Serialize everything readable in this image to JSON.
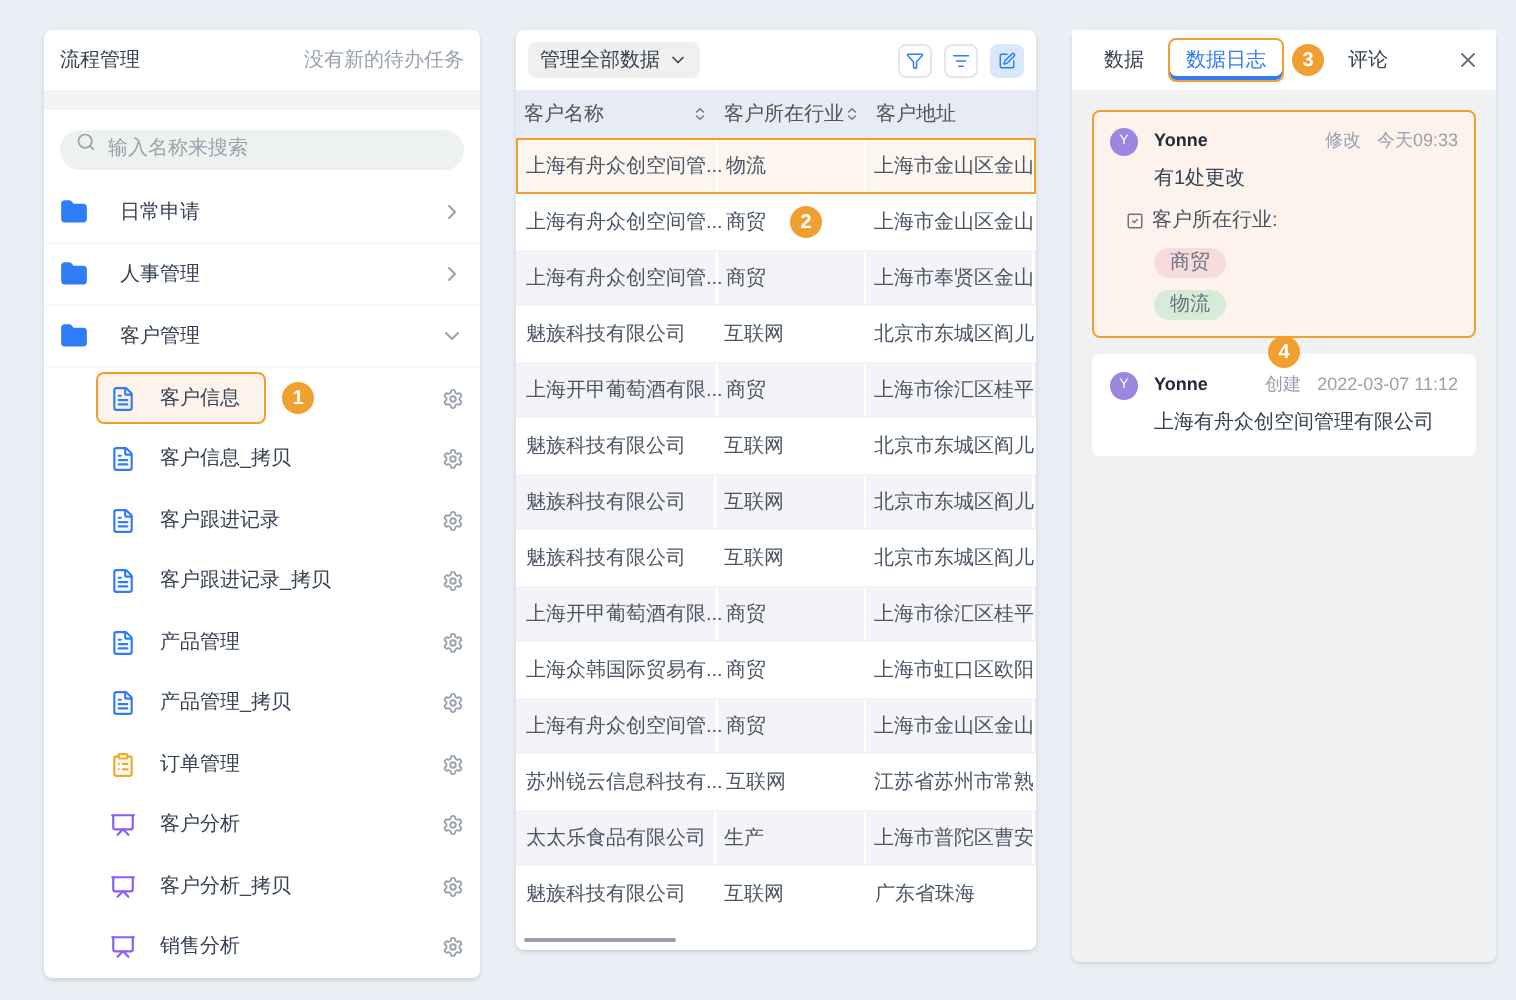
{
  "left_panel": {
    "title": "流程管理",
    "notice": "没有新的待办任务",
    "search": {
      "placeholder": "输入名称来搜索"
    },
    "folders": [
      {
        "label": "日常申请",
        "expanded": false
      },
      {
        "label": "人事管理",
        "expanded": false
      },
      {
        "label": "客户管理",
        "expanded": true,
        "children": [
          {
            "label": "客户信息",
            "kind": "form",
            "selected": true,
            "badge": "1"
          },
          {
            "label": "客户信息_拷贝",
            "kind": "form",
            "selected": false
          },
          {
            "label": "客户跟进记录",
            "kind": "form",
            "selected": false
          },
          {
            "label": "客户跟进记录_拷贝",
            "kind": "form",
            "selected": false
          },
          {
            "label": "产品管理",
            "kind": "form",
            "selected": false
          },
          {
            "label": "产品管理_拷贝",
            "kind": "form",
            "selected": false
          },
          {
            "label": "订单管理",
            "kind": "flow",
            "selected": false
          },
          {
            "label": "客户分析",
            "kind": "report",
            "selected": false
          },
          {
            "label": "客户分析_拷贝",
            "kind": "report",
            "selected": false
          },
          {
            "label": "销售分析",
            "kind": "report",
            "selected": false
          }
        ]
      }
    ]
  },
  "middle_panel": {
    "view_select": "管理全部数据",
    "table": {
      "columns": [
        "客户名称",
        "客户所在行业",
        "客户地址"
      ],
      "rows": [
        {
          "cells": [
            "上海有舟众创空间管...",
            "物流",
            "上海市金山区金山"
          ],
          "selected": true
        },
        {
          "cells": [
            "上海有舟众创空间管...",
            "商贸",
            "上海市金山区金山"
          ],
          "selected": false,
          "badge": "2"
        },
        {
          "cells": [
            "上海有舟众创空间管...",
            "商贸",
            "上海市奉贤区金山"
          ],
          "selected": false
        },
        {
          "cells": [
            "魅族科技有限公司",
            "互联网",
            "北京市东城区阎儿"
          ],
          "selected": false
        },
        {
          "cells": [
            "上海开甲葡萄酒有限...",
            "商贸",
            "上海市徐汇区桂平"
          ],
          "selected": false
        },
        {
          "cells": [
            "魅族科技有限公司",
            "互联网",
            "北京市东城区阎儿"
          ],
          "selected": false
        },
        {
          "cells": [
            "魅族科技有限公司",
            "互联网",
            "北京市东城区阎儿"
          ],
          "selected": false
        },
        {
          "cells": [
            "魅族科技有限公司",
            "互联网",
            "北京市东城区阎儿"
          ],
          "selected": false
        },
        {
          "cells": [
            "上海开甲葡萄酒有限...",
            "商贸",
            "上海市徐汇区桂平"
          ],
          "selected": false
        },
        {
          "cells": [
            "上海众韩国际贸易有...",
            "商贸",
            "上海市虹口区欧阳"
          ],
          "selected": false
        },
        {
          "cells": [
            "上海有舟众创空间管...",
            "商贸",
            "上海市金山区金山"
          ],
          "selected": false
        },
        {
          "cells": [
            "苏州锐云信息科技有...",
            "互联网",
            "江苏省苏州市常熟"
          ],
          "selected": false
        },
        {
          "cells": [
            "太太乐食品有限公司",
            "生产",
            "上海市普陀区曹安"
          ],
          "selected": false
        },
        {
          "cells": [
            "魅族科技有限公司",
            "互联网",
            "广东省珠海"
          ],
          "selected": false
        }
      ]
    }
  },
  "right_panel": {
    "tabs": [
      {
        "label": "数据",
        "selected": false
      },
      {
        "label": "数据日志",
        "selected": true,
        "badge": "3"
      },
      {
        "label": "评论",
        "selected": false
      }
    ],
    "logs": [
      {
        "avatar": "Y",
        "user": "Yonne",
        "action": "修改",
        "time": "今天09:33",
        "selected": true,
        "summary": "有1处更改",
        "field": "客户所在行业:",
        "tags": [
          {
            "text": "商贸",
            "color": "#f8dcdc"
          },
          {
            "text": "物流",
            "color": "#d6ecd6"
          }
        ]
      },
      {
        "avatar": "Y",
        "user": "Yonne",
        "action": "创建",
        "time": "2022-03-07 11:12",
        "selected": false,
        "badge": "4",
        "summary": "上海有舟众创空间管理有限公司"
      }
    ]
  }
}
